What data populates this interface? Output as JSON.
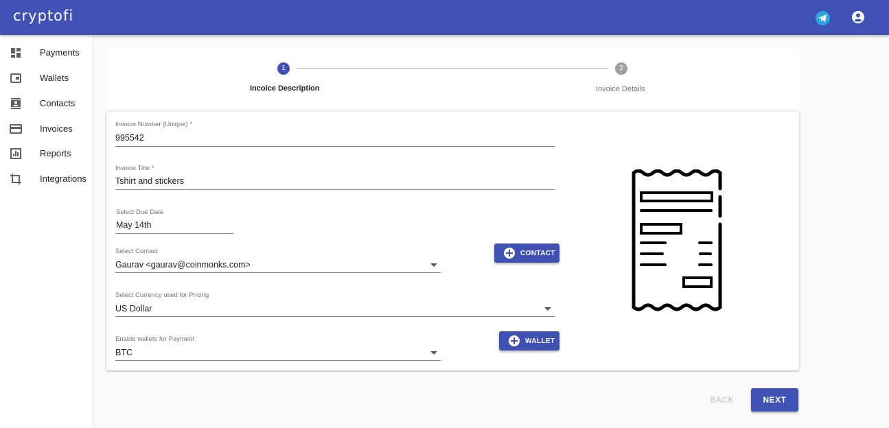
{
  "app": {
    "brand": "cryptofi"
  },
  "header": {
    "icons": [
      "telegram-icon",
      "account-circle-icon"
    ]
  },
  "sidebar": {
    "items": [
      {
        "label": "Payments",
        "icon": "dashboard-icon"
      },
      {
        "label": "Wallets",
        "icon": "wallet-icon"
      },
      {
        "label": "Contacts",
        "icon": "contacts-icon"
      },
      {
        "label": "Invoices",
        "icon": "credit-card-icon"
      },
      {
        "label": "Reports",
        "icon": "chart-icon"
      },
      {
        "label": "Integrations",
        "icon": "crop-icon"
      }
    ]
  },
  "stepper": {
    "steps": [
      {
        "number": "1",
        "label": "Incoice Description",
        "active": true
      },
      {
        "number": "2",
        "label": "Invoice Details",
        "active": false
      }
    ]
  },
  "form": {
    "invoice_number": {
      "label": "Invoice Number (Unique) *",
      "value": "995542"
    },
    "invoice_title": {
      "label": "Invoice Title *",
      "value": "Tshirt and stickers"
    },
    "due_date": {
      "label": "Select Due Date",
      "value": "May 14th"
    },
    "contact": {
      "label": "Select Contact",
      "value": "Gaurav <gaurav@coinmonks.com>",
      "button": "CONTACT"
    },
    "currency": {
      "label": "Select Currency used for Pricing",
      "value": "US Dollar"
    },
    "wallets": {
      "label": "Enable wallets for Payment",
      "value": "BTC",
      "button": "WALLET"
    }
  },
  "actions": {
    "back": "BACK",
    "next": "NEXT"
  },
  "colors": {
    "primary": "#3f51b5",
    "telegram": "#2ca5e0",
    "inactive_step": "#9e9e9e"
  }
}
